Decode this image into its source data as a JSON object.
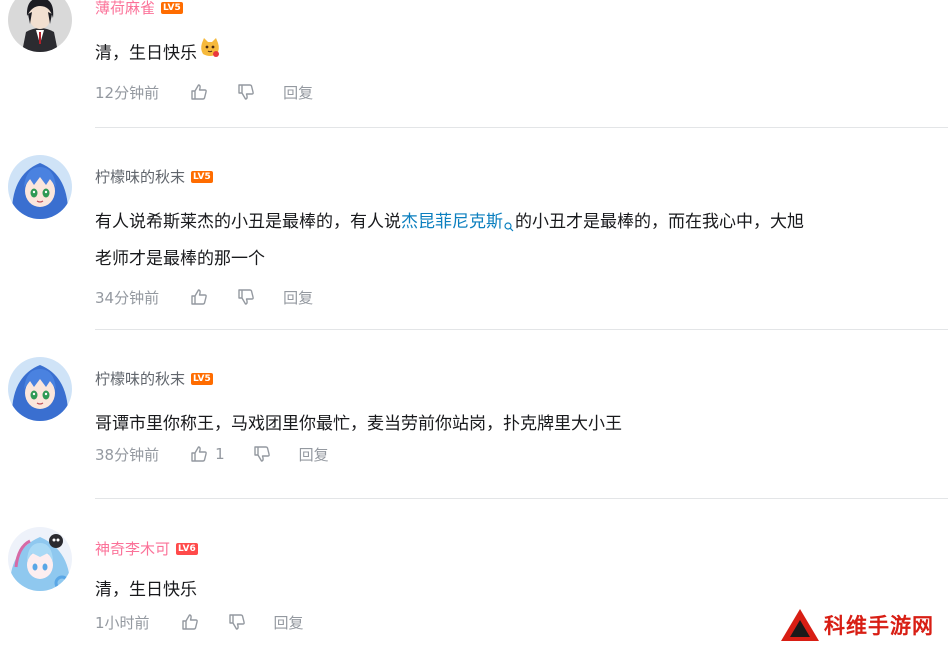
{
  "comments": [
    {
      "username": "薄荷麻雀",
      "level": "LV5",
      "level_color": "#ff6c00",
      "name_color": "pink",
      "content": "清，生日快乐",
      "emoji": "cat-emoji-icon",
      "time": "12分钟前",
      "likes": "",
      "reply_label": "回复"
    },
    {
      "username": "柠檬味的秋末",
      "level": "LV5",
      "level_color": "#ff6c00",
      "name_color": "gray",
      "content_before": "有人说希斯莱杰的小丑是最棒的，有人说",
      "content_link": "杰昆菲尼克斯",
      "content_after": "的小丑才是最棒的，而在我心中，大旭",
      "content_line2": "老师才是最棒的那一个",
      "time": "34分钟前",
      "likes": "",
      "reply_label": "回复"
    },
    {
      "username": "柠檬味的秋末",
      "level": "LV5",
      "level_color": "#ff6c00",
      "name_color": "gray",
      "content": "哥谭市里你称王，马戏团里你最忙，麦当劳前你站岗，扑克牌里大小王",
      "time": "38分钟前",
      "likes": "1",
      "reply_label": "回复"
    },
    {
      "username": "神奇李木可",
      "level": "LV6",
      "level_color": "#ff4a4a",
      "name_color": "pink",
      "content": "清，生日快乐",
      "time": "1小时前",
      "likes": "",
      "reply_label": "回复"
    }
  ],
  "watermark": {
    "text": "科维手游网",
    "color": "#d81e14"
  }
}
